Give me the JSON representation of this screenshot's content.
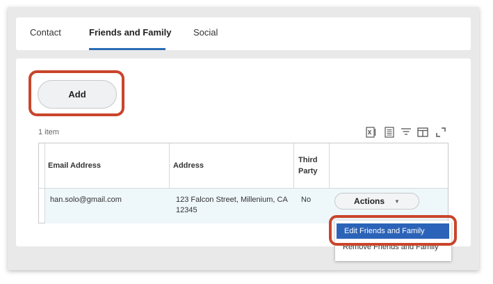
{
  "tabs": [
    {
      "label": "Contact"
    },
    {
      "label": "Friends and Family"
    },
    {
      "label": "Social"
    }
  ],
  "add_button": {
    "label": "Add"
  },
  "table": {
    "count_text": "1 item",
    "columns": [
      "Email Address",
      "Address",
      "Third Party",
      ""
    ],
    "rows": [
      {
        "email": "han.solo@gmail.com",
        "address": "123 Falcon Street, Millenium, CA 12345",
        "third_party": "No"
      }
    ]
  },
  "actions": {
    "label": "Actions",
    "caret": "▼"
  },
  "menu": {
    "items": [
      {
        "label": "Edit Friends and Family"
      },
      {
        "label": "Remove Friends and Family"
      }
    ]
  },
  "toolbar_icons": [
    "excel-export-icon",
    "print-icon",
    "filter-icon",
    "columns-icon",
    "fullscreen-icon"
  ],
  "colors": {
    "accent": "#2b6cb5",
    "highlight": "#c9452c",
    "menu_selected": "#2b63b8"
  }
}
